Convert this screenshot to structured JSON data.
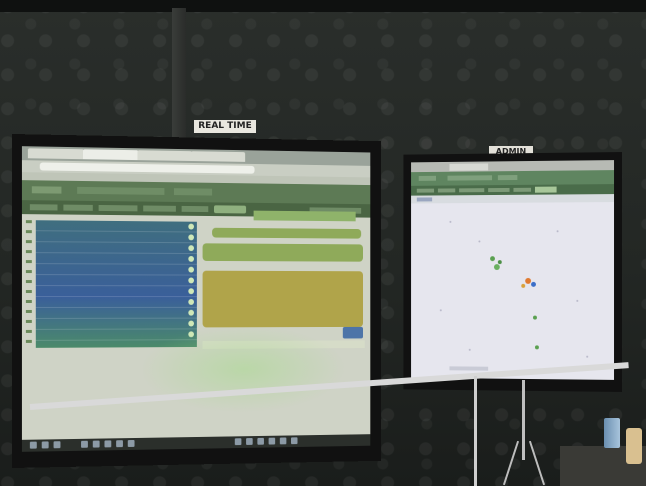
{
  "labels": {
    "left": "REAL TIME",
    "right": "ADMIN"
  },
  "colors": {
    "app_green": "#5d7a55",
    "menu_green": "#4a6543",
    "list_blue": "#3a5f9a",
    "bubble_green": "#8faa5a",
    "send_blue": "#4d74a8",
    "map_bg": "#e6e6ee"
  },
  "icons": [
    "browser-tab-icon",
    "check-icon",
    "send-icon",
    "taskbar-app-icon",
    "map-marker-icon"
  ]
}
